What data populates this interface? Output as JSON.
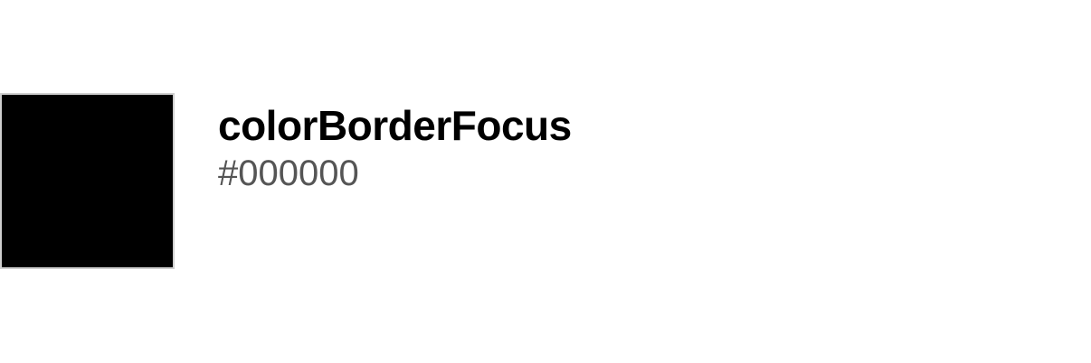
{
  "token": {
    "name": "colorBorderFocus",
    "value": "#000000",
    "swatch_color": "#000000",
    "swatch_border_color": "#cfcfcf"
  }
}
